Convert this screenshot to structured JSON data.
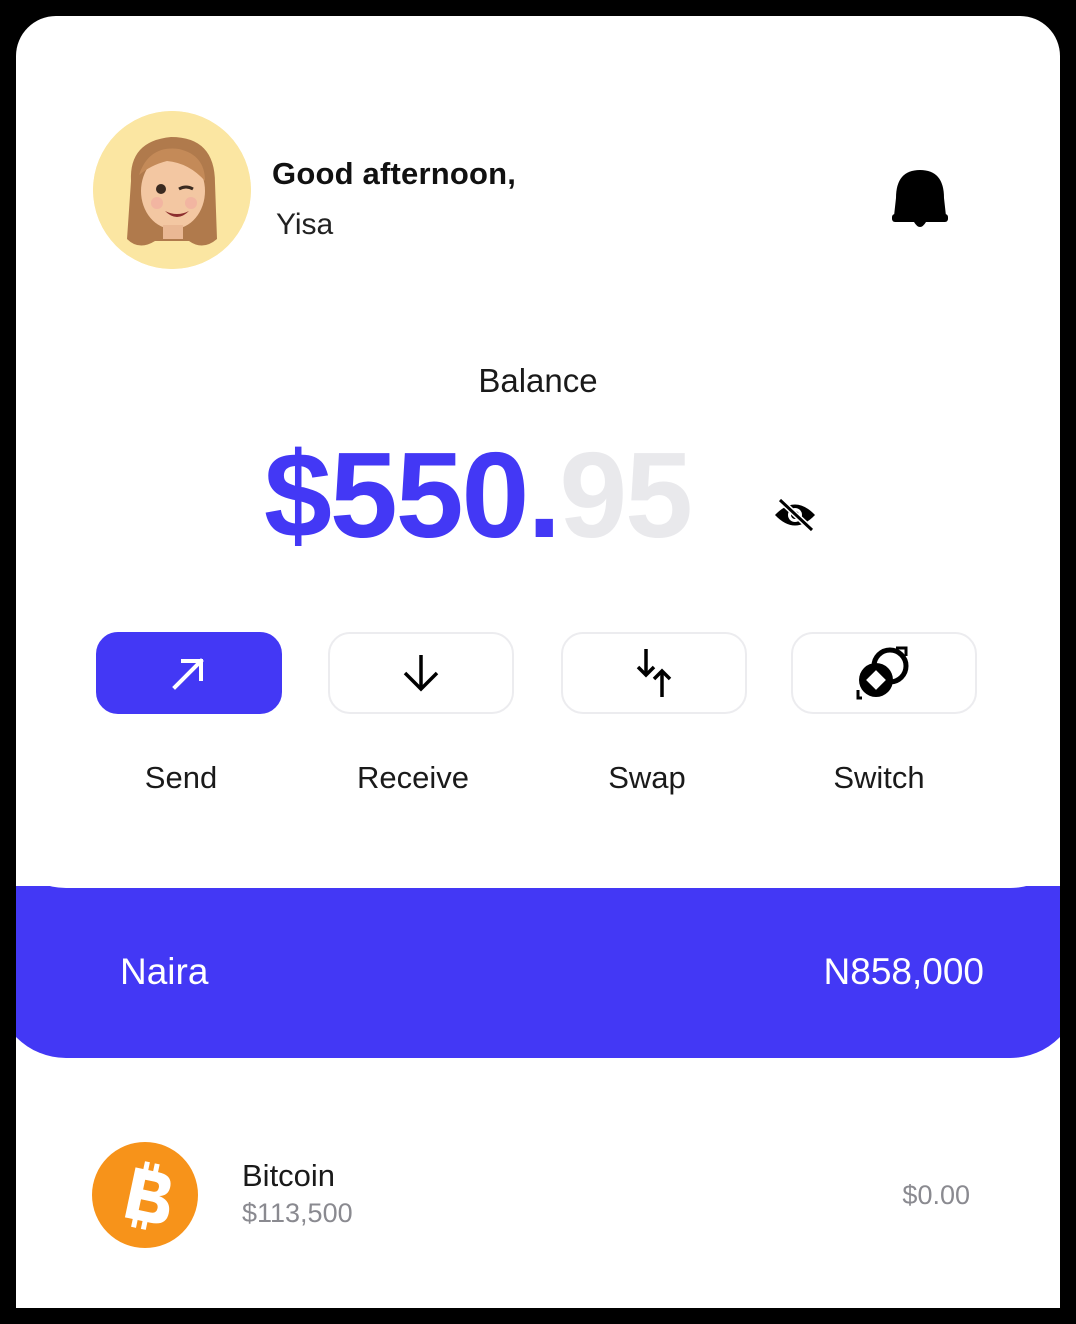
{
  "header": {
    "greeting": "Good afternoon,",
    "username": "Yisa"
  },
  "balance": {
    "label": "Balance",
    "whole": "$550.",
    "cents": "95"
  },
  "actions": [
    {
      "label": "Send",
      "icon": "arrow-up-right-icon"
    },
    {
      "label": "Receive",
      "icon": "arrow-down-icon"
    },
    {
      "label": "Swap",
      "icon": "swap-arrows-icon"
    },
    {
      "label": "Switch",
      "icon": "switch-coins-icon"
    }
  ],
  "currency_bar": {
    "name": "Naira",
    "value": "N858,000"
  },
  "assets": [
    {
      "name": "Bitcoin",
      "price": "$113,500",
      "balance": "$0.00",
      "icon": "bitcoin-icon"
    }
  ],
  "colors": {
    "accent": "#4338f5",
    "bitcoin": "#f7931a",
    "avatar_bg": "#fbe6a2"
  }
}
